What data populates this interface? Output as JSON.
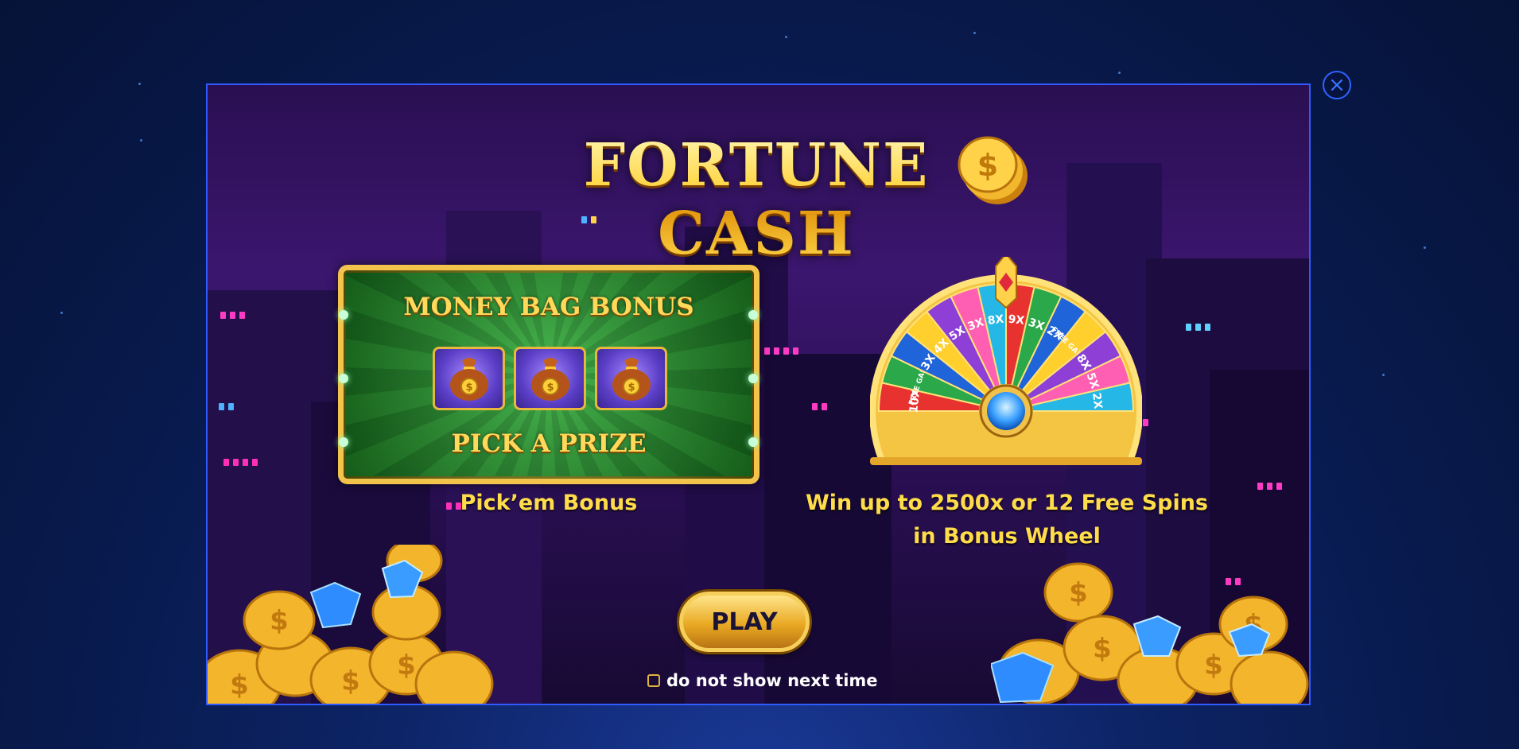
{
  "modal": {
    "title": "FORTUNE CASH",
    "close_label": "×"
  },
  "pickem": {
    "heading": "MONEY BAG BONUS",
    "subheading": "PICK A PRIZE",
    "caption": "Pick’em Bonus",
    "bags": [
      "money-bag-1",
      "money-bag-2",
      "money-bag-3"
    ]
  },
  "wheel": {
    "caption_line1": "Win up to 2500x or 12 Free Spins",
    "caption_line2": "in Bonus Wheel",
    "segments": [
      "10X",
      "FREE GAMES",
      "3X",
      "4X",
      "5X",
      "3X",
      "8X",
      "9X",
      "3X",
      "2X",
      "FREE GAMES",
      "8X",
      "5X",
      "2X"
    ]
  },
  "actions": {
    "play_label": "PLAY",
    "dont_show_label": "do not show next time",
    "dont_show_checked": false
  },
  "colors": {
    "frame_border": "#2f5bff",
    "gold": "#ffd23e",
    "caption_yellow": "#ffdd4a",
    "panel_green": "#2d9a37"
  }
}
